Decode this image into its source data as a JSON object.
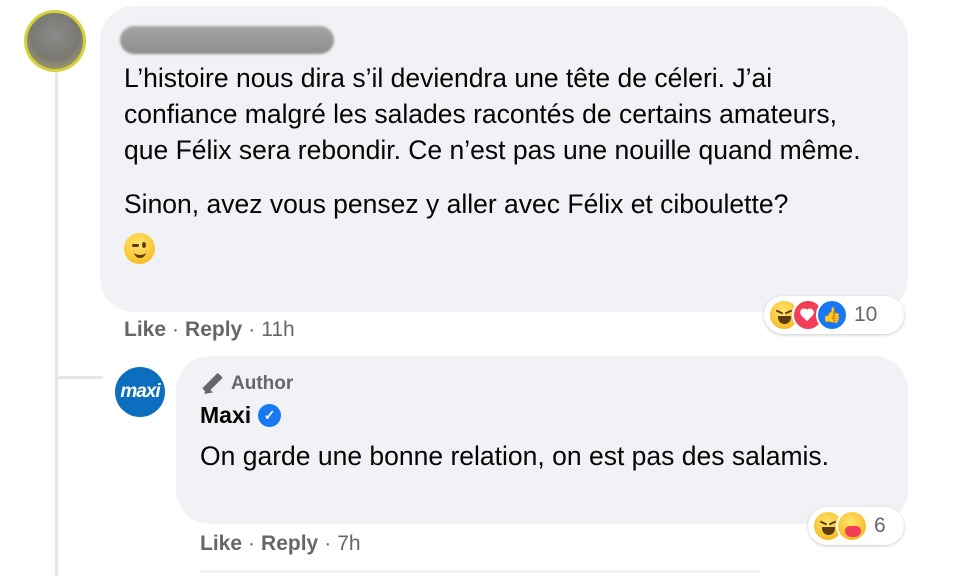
{
  "comment": {
    "author_name_redacted": "",
    "paragraphs": [
      "L’histoire nous dira s’il deviendra une tête de céleri. J’ai confiance malgré les salades racontés de certains amateurs, que Félix sera rebondir. Ce n’est pas une nouille quand même.",
      "Sinon, avez vous pensez y aller avec Félix et ciboulette?"
    ],
    "emoji": "wink-emoji",
    "reactions": {
      "icons": [
        "haha",
        "love",
        "like"
      ],
      "count": "10"
    },
    "actions": {
      "like": "Like",
      "reply": "Reply",
      "time": "11h",
      "separator": "·"
    }
  },
  "reply": {
    "avatar_text": "maxi",
    "badge_label": "Author",
    "author_name": "Maxi",
    "verified_icon": "✓",
    "text": "On garde une bonne relation, on est pas des salamis.",
    "reactions": {
      "icons": [
        "haha",
        "care"
      ],
      "count": "6"
    },
    "actions": {
      "like": "Like",
      "reply": "Reply",
      "time": "7h",
      "separator": "·"
    }
  },
  "colors": {
    "bubble": "#f0f2f5",
    "meta_text": "#65676b",
    "brand_blue": "#1877f2",
    "maxi_blue": "#0c6ebf",
    "love_red": "#f33e58"
  }
}
